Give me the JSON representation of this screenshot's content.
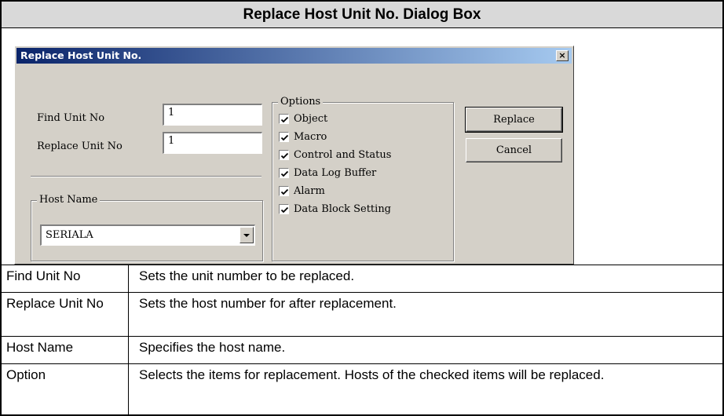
{
  "title": "Replace Host Unit No. Dialog Box",
  "dialog": {
    "title": "Replace Host Unit No.",
    "close_glyph": "×",
    "find_unit_label": "Find Unit No",
    "find_unit_value": "1",
    "replace_unit_label": "Replace Unit No",
    "replace_unit_value": "1",
    "host_name_label": "Host Name",
    "host_name_value": "SERIALA",
    "options_label": "Options",
    "options": [
      {
        "label": "Object",
        "checked": true
      },
      {
        "label": "Macro",
        "checked": true
      },
      {
        "label": "Control and Status",
        "checked": true
      },
      {
        "label": "Data Log Buffer",
        "checked": true
      },
      {
        "label": "Alarm",
        "checked": true
      },
      {
        "label": "Data Block Setting",
        "checked": true
      }
    ],
    "replace_button": "Replace",
    "cancel_button": "Cancel"
  },
  "descriptions": [
    {
      "term": "Find Unit No",
      "desc": "Sets the unit number to be replaced."
    },
    {
      "term": "Replace Unit No",
      "desc": "Sets the host number for after replacement."
    },
    {
      "term": "Host Name",
      "desc": "Specifies the host name."
    },
    {
      "term": "Option",
      "desc": "Selects the items for replacement. Hosts of the checked items will be replaced."
    }
  ]
}
